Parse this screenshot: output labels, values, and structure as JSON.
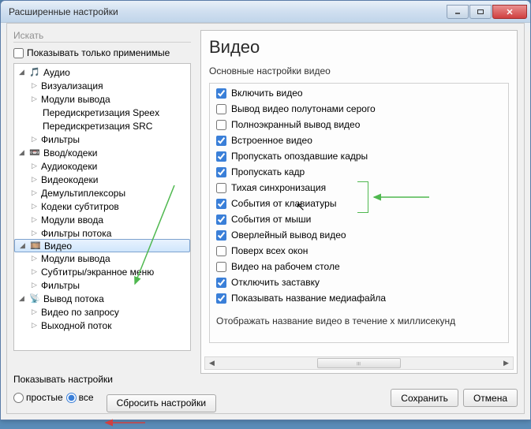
{
  "window": {
    "title": "Расширенные настройки"
  },
  "left": {
    "search_label": "Искать",
    "show_applicable": "Показывать только применимые",
    "tree": {
      "audio": "Аудио",
      "audio_viz": "Визуализация",
      "audio_out": "Модули вывода",
      "audio_speex": "Передискретизация Speex",
      "audio_src": "Передискретизация SRC",
      "audio_filt": "Фильтры",
      "input": "Ввод/кодеки",
      "input_ac": "Аудиокодеки",
      "input_vc": "Видеокодеки",
      "input_demux": "Демультиплексоры",
      "input_subcod": "Кодеки субтитров",
      "input_modin": "Модули ввода",
      "input_streamfilt": "Фильтры потока",
      "video": "Видео",
      "video_out": "Модули вывода",
      "video_sub": "Субтитры/экранное меню",
      "video_filt": "Фильтры",
      "outstream": "Вывод потока",
      "out_vod": "Видео по запросу",
      "out_stream": "Выходной поток"
    }
  },
  "right": {
    "title": "Видео",
    "section": "Основные настройки видео",
    "opts": {
      "enable": "Включить видео",
      "gray": "Вывод видео полутонами серого",
      "fullscreen": "Полноэкранный вывод видео",
      "embedded": "Встроенное видео",
      "droplate": "Пропускать опоздавшие кадры",
      "skip": "Пропускать кадр",
      "quiet": "Тихая синхронизация",
      "kbd": "События от клавиатуры",
      "mouse": "События от мыши",
      "overlay": "Оверлейный вывод видео",
      "ontop": "Поверх всех окон",
      "wallpaper": "Видео на рабочем столе",
      "nosplash": "Отключить заставку",
      "showtitle": "Показывать название медиафайла"
    },
    "footer": "Отображать название видео в течение x миллисекунд"
  },
  "bottom": {
    "label": "Показывать настройки",
    "simple": "простые",
    "all": "все",
    "reset": "Сбросить настройки",
    "save": "Сохранить",
    "cancel": "Отмена"
  }
}
